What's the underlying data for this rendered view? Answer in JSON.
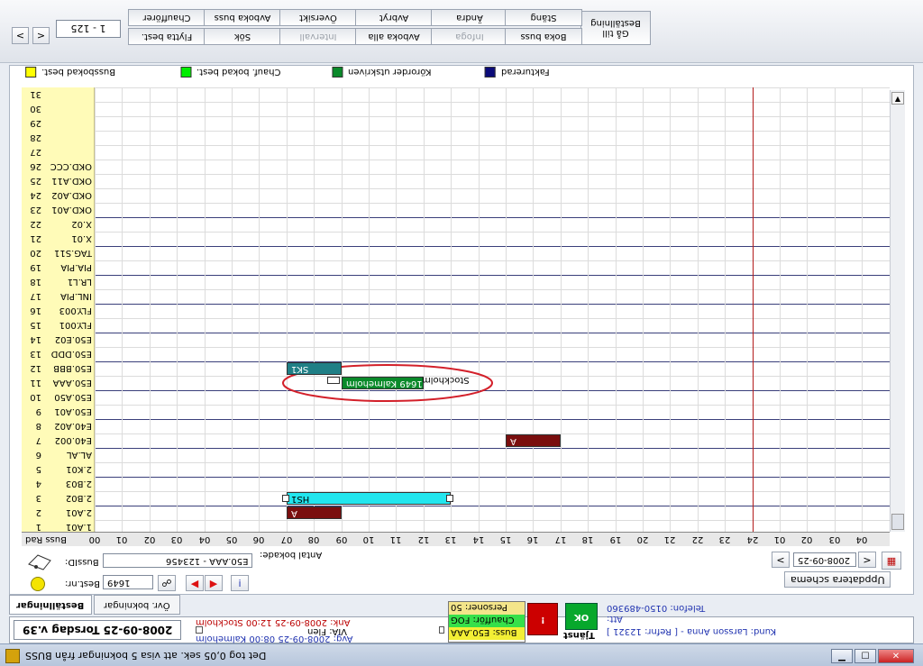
{
  "toolbar": {
    "row_top": [
      "Chaufförer",
      "Avboka buss",
      "Översikt",
      "Avbryt",
      "Ändra",
      "Stäng"
    ],
    "row_bottom": [
      "Flytta best.",
      "Sök",
      "Intervall",
      "Avboka alla",
      "Infoga",
      "Boka buss"
    ],
    "disabled_bottom": [
      "Intervall",
      "Infoga"
    ],
    "order_btn": "Beställning",
    "goto_btn": "Gå till",
    "range": "1 - 125",
    "nav_prev": "<",
    "nav_next": ">"
  },
  "legend": [
    {
      "label": "Bussbokad best.",
      "color": "#ffff00"
    },
    {
      "label": "Chauf. bokad best.",
      "color": "#00ee00"
    },
    {
      "label": "Körorder utskriven",
      "color": "#0a8a2a"
    },
    {
      "label": "Fakturerad",
      "color": "#0b0b7a"
    }
  ],
  "row_header": {
    "rad": "Rad",
    "buss": "Buss"
  },
  "rows": [
    {
      "n": "1",
      "bus": "1.A01"
    },
    {
      "n": "2",
      "bus": "2.A01"
    },
    {
      "n": "3",
      "bus": "2.B02"
    },
    {
      "n": "4",
      "bus": "2.B03"
    },
    {
      "n": "5",
      "bus": "2.K01"
    },
    {
      "n": "6",
      "bus": "AL.AL"
    },
    {
      "n": "7",
      "bus": "E40.002"
    },
    {
      "n": "8",
      "bus": "E40.A02"
    },
    {
      "n": "9",
      "bus": "E50.A01"
    },
    {
      "n": "10",
      "bus": "E50.A50"
    },
    {
      "n": "11",
      "bus": "E50.AAA"
    },
    {
      "n": "12",
      "bus": "E50.BBB"
    },
    {
      "n": "13",
      "bus": "E50.DDD"
    },
    {
      "n": "14",
      "bus": "E50.E02"
    },
    {
      "n": "15",
      "bus": "FLY.001"
    },
    {
      "n": "16",
      "bus": "FLY.003"
    },
    {
      "n": "17",
      "bus": "INL.PIA"
    },
    {
      "n": "18",
      "bus": "LR.L1"
    },
    {
      "n": "19",
      "bus": "PIA.PIA"
    },
    {
      "n": "20",
      "bus": "TAG.S11"
    },
    {
      "n": "21",
      "bus": "X.01"
    },
    {
      "n": "22",
      "bus": "X.02"
    },
    {
      "n": "23",
      "bus": "OKD.A01"
    },
    {
      "n": "24",
      "bus": "OKD.A02"
    },
    {
      "n": "25",
      "bus": "OKD.A11"
    },
    {
      "n": "26",
      "bus": "OKD.CCC"
    },
    {
      "n": "27",
      "bus": ""
    },
    {
      "n": "28",
      "bus": ""
    },
    {
      "n": "29",
      "bus": ""
    },
    {
      "n": "30",
      "bus": ""
    },
    {
      "n": "31",
      "bus": ""
    }
  ],
  "hours": [
    "00",
    "01",
    "02",
    "03",
    "04",
    "05",
    "06",
    "07",
    "08",
    "09",
    "10",
    "11",
    "12",
    "13",
    "14",
    "15",
    "16",
    "17",
    "18",
    "19",
    "20",
    "21",
    "22",
    "23",
    "24",
    "01",
    "02",
    "03",
    "04"
  ],
  "bookings": [
    {
      "row": 2,
      "start": 7,
      "end": 9,
      "label": "A",
      "color": "#7a0e0e",
      "text_color": "#ffffff"
    },
    {
      "row": 3,
      "start": 7,
      "end": 13,
      "label": "HS1",
      "color": "#22e6ee",
      "text_color": "#000000"
    },
    {
      "row": 7,
      "start": 15,
      "end": 17,
      "label": "A",
      "color": "#7a0e0e",
      "text_color": "#ffffff"
    },
    {
      "row": 11,
      "start": 9,
      "end": 12,
      "label": "1649 Kalmeholm",
      "color": "#0a8a2a",
      "text_color": "#ffffff"
    },
    {
      "row": 12,
      "start": 7,
      "end": 9,
      "label": "SK1",
      "color": "#1f7f86",
      "text_color": "#ffffff"
    }
  ],
  "ghost_label": "Stockholm",
  "bottom": {
    "bussid_label": "BussID:",
    "bussid_value": "E50.AAA - 123456",
    "bestnr_label": "Best.nr:",
    "bestnr_value": "1649",
    "antal_label": "Antal bokade:",
    "date_value": "2008-09-25",
    "update_btn": "Uppdatera schema"
  },
  "tabs": [
    "Beställningar",
    "Övr. bokningar"
  ],
  "info": {
    "date_title": "2008-09-25 Torsdag v.39",
    "ank": "Ank: 2008-09-25 12:00 Stockholm",
    "via": "VIA: Flen",
    "avg": "Avg: 2008-09-25 08:00 Kalmeholm",
    "personer": "Personer: 50",
    "chauffor": "Chaufför: FOG",
    "buss": "Buss: E50.AAA",
    "kund": "Kund: Larsson Anna - [ Refnr: 12321 ]",
    "telefon": "Telefon: 0150-489360",
    "att": "Att:",
    "tjanst": "Tjänst",
    "ok_btn": "OK",
    "excl_btn": "!"
  },
  "status": "Det tog 0,05 sek. att visa 5 bokningar från BUSS"
}
